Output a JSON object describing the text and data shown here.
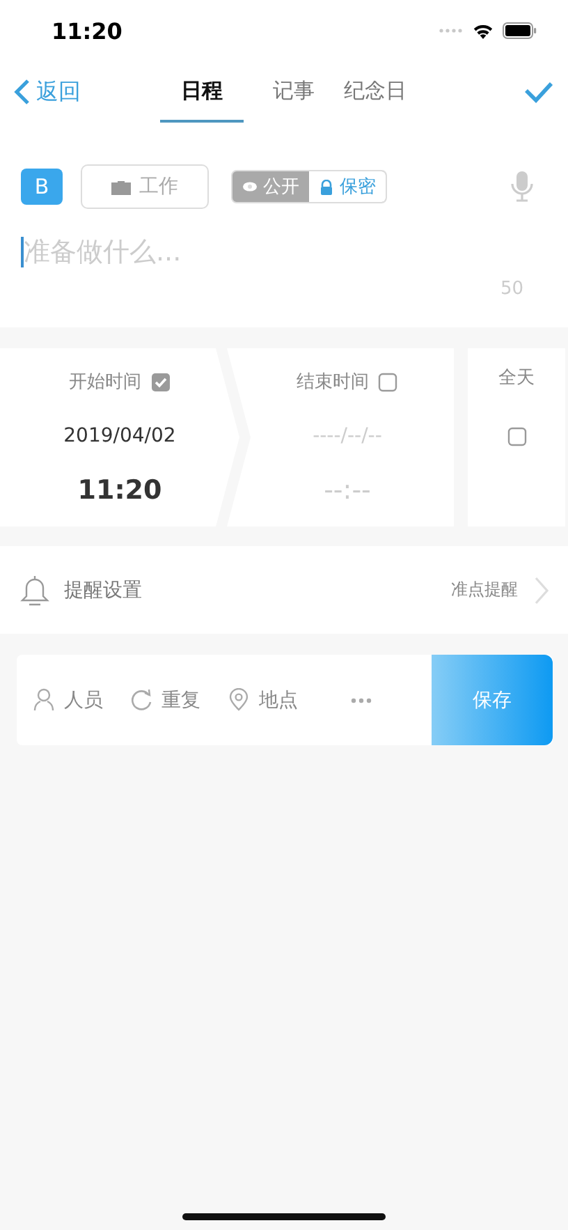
{
  "status_bar": {
    "time": "11:20"
  },
  "nav": {
    "back": "返回",
    "tabs": [
      {
        "label": "日程",
        "selected": true
      },
      {
        "label": "记事",
        "selected": false
      },
      {
        "label": "纪念日",
        "selected": false
      }
    ]
  },
  "editor": {
    "badge": "B",
    "category": "工作",
    "privacy": [
      {
        "label": "公开",
        "selected": false
      },
      {
        "label": "保密",
        "selected": true
      }
    ],
    "placeholder": "准备做什么...",
    "counter": "50"
  },
  "times": [
    {
      "label": "开始时间",
      "checked": true,
      "date": "2019/04/02",
      "time": "11:20"
    },
    {
      "label": "结束时间",
      "checked": false,
      "date": "----/--/--",
      "time": "--:--"
    }
  ],
  "all_day": {
    "label": "全天",
    "checked": false
  },
  "reminder": {
    "label": "提醒设置",
    "value": "准点提醒"
  },
  "actions": [
    {
      "kind": "people",
      "label": "人员"
    },
    {
      "kind": "repeat",
      "label": "重复"
    },
    {
      "kind": "location",
      "label": "地点"
    },
    {
      "kind": "more"
    }
  ],
  "save": "保存"
}
